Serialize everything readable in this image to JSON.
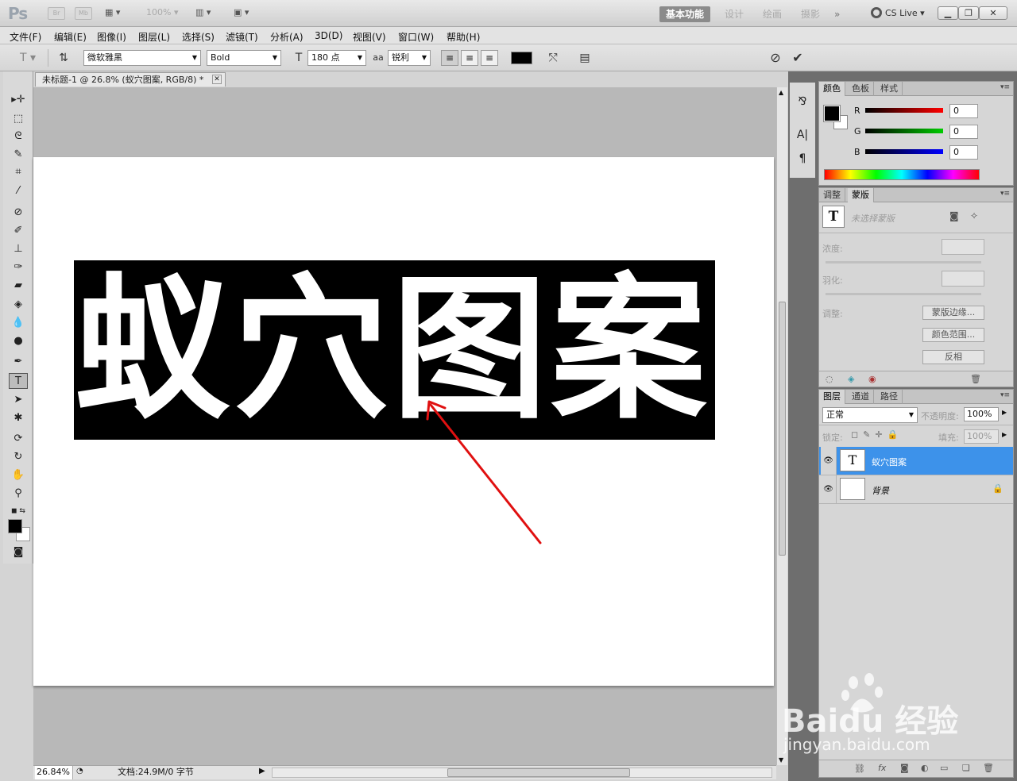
{
  "app": {
    "logo": "Ps",
    "bridge": "Br",
    "mini_bridge": "Mb",
    "zoom_preset": "100%",
    "workspaces": [
      "基本功能",
      "设计",
      "绘画",
      "摄影",
      "»"
    ],
    "cs_live": "CS Live"
  },
  "menu": [
    "文件(F)",
    "编辑(E)",
    "图像(I)",
    "图层(L)",
    "选择(S)",
    "滤镜(T)",
    "分析(A)",
    "3D(D)",
    "视图(V)",
    "窗口(W)",
    "帮助(H)"
  ],
  "options": {
    "font_family": "微软雅黑",
    "font_style": "Bold",
    "font_size": "180 点",
    "aa_label": "aa",
    "antialias": "锐利",
    "text_color": "#000000"
  },
  "document": {
    "tab_title": "未标题-1 @ 26.8% (蚁穴图案, RGB/8) *",
    "canvas_text": "蚁穴图案",
    "text_block_color": "#000000",
    "arrow_color": "#e01010"
  },
  "status": {
    "zoom": "26.84%",
    "doc_info": "文档:24.9M/0 字节"
  },
  "color_panel": {
    "tabs": [
      "颜色",
      "色板",
      "样式"
    ],
    "channels": [
      {
        "label": "R",
        "value": "0",
        "color": "#d00000"
      },
      {
        "label": "G",
        "value": "0",
        "color": "#00b000"
      },
      {
        "label": "B",
        "value": "0",
        "color": "#0000c8"
      }
    ]
  },
  "mask_panel": {
    "tabs": [
      "调整",
      "蒙版"
    ],
    "no_mask": "未选择蒙版",
    "density": "浓度:",
    "feather": "羽化:",
    "refine": "调整:",
    "buttons": [
      "蒙版边缘...",
      "颜色范围...",
      "反相"
    ]
  },
  "layers_panel": {
    "tabs": [
      "图层",
      "通道",
      "路径"
    ],
    "blend_mode": "正常",
    "opacity_label": "不透明度:",
    "opacity": "100%",
    "lock_label": "锁定:",
    "fill_label": "填充:",
    "fill": "100%",
    "layers": [
      {
        "name": "蚁穴图案",
        "thumb": "T",
        "selected": true
      },
      {
        "name": "背景",
        "thumb": "",
        "selected": false
      }
    ],
    "footer_fx": "fx"
  },
  "watermark": {
    "brand": "Bai",
    "brand_tail": "du",
    "product": "经验",
    "site": "jingyan.baidu.com"
  }
}
